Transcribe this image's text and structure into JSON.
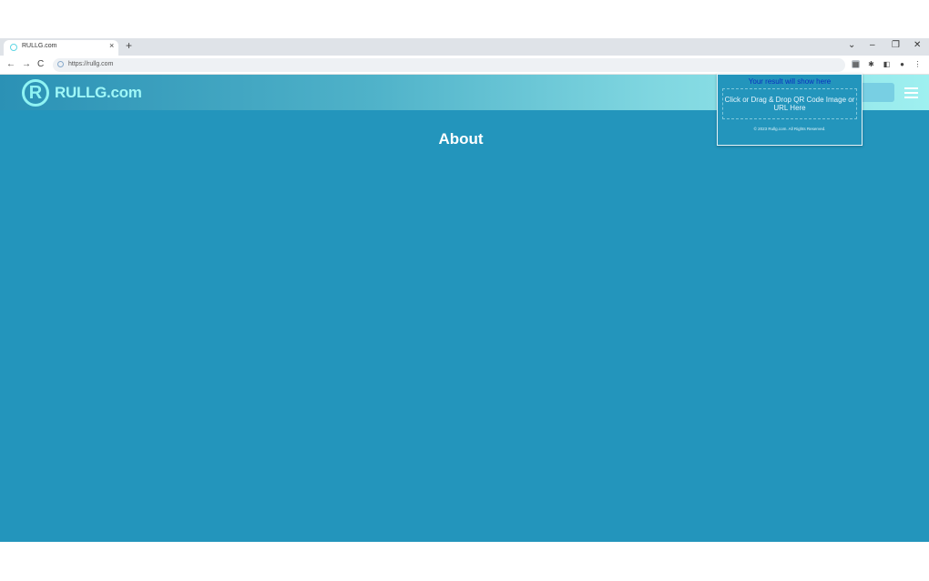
{
  "browser": {
    "tab_title": "RULLG.com",
    "tab_close": "×",
    "new_tab": "+",
    "window_controls": {
      "tab_search": "⌄",
      "minimize": "–",
      "restore": "❐",
      "close": "✕"
    },
    "nav": {
      "back": "←",
      "forward": "→",
      "reload": "C"
    },
    "url": "https://rullg.com",
    "extensions": [
      "qr-icon",
      "puzzle-icon",
      "sidebar-icon",
      "profile-icon",
      "menu-icon"
    ]
  },
  "site": {
    "logo_letter": "R",
    "logo_text": "RULLG.com",
    "heading": "About",
    "colors": {
      "background": "#2395bc",
      "logo": "#9ff7f7"
    }
  },
  "popup": {
    "result_text": "Your result will show here",
    "drop_text": "Click or Drag & Drop QR Code Image or URL Here",
    "footer": "© 2023 Rullg.com. All Rights Reserved."
  }
}
